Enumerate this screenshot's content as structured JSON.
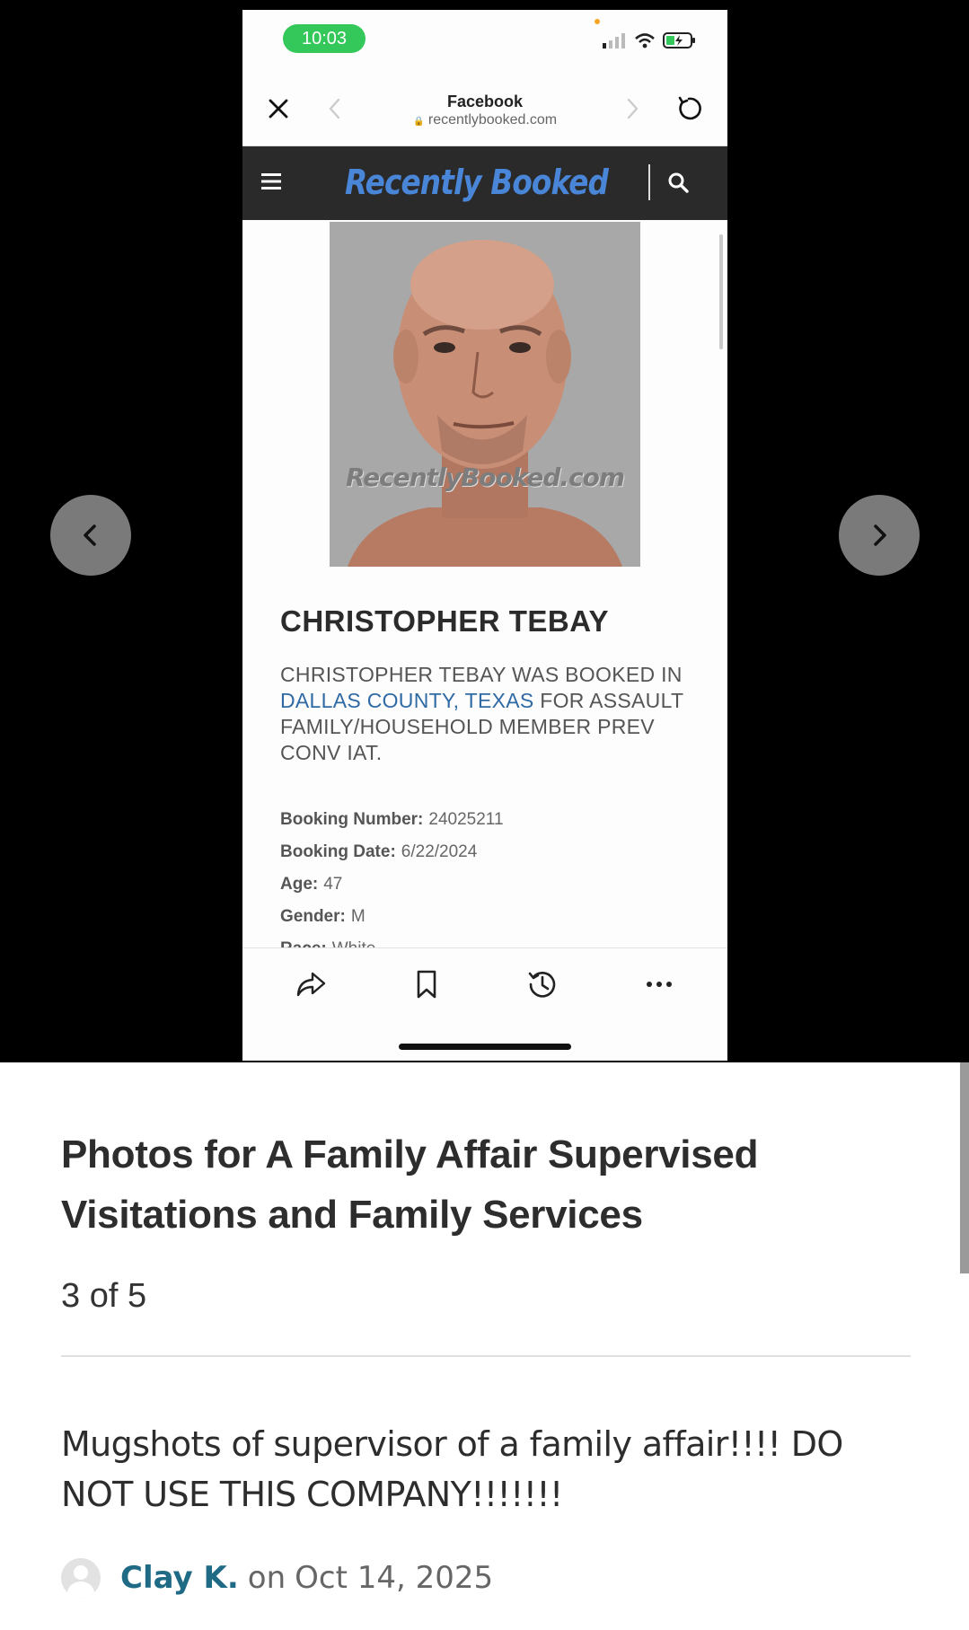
{
  "viewer": {
    "prev_label": "Previous photo",
    "next_label": "Next photo"
  },
  "phone": {
    "time": "10:03",
    "browser": {
      "title": "Facebook",
      "url": "recentlybooked.com"
    },
    "site": {
      "logo": "Recently Booked"
    },
    "mugshot_watermark": "RecentlyBooked.com",
    "person_name": "CHRISTOPHER TEBAY",
    "description": {
      "part1": "CHRISTOPHER TEBAY WAS BOOKED IN ",
      "link": "DALLAS COUNTY, TEXAS",
      "part2": " FOR ASSAULT FAMILY/HOUSEHOLD MEMBER PREV CONV IAT."
    },
    "details": [
      {
        "label": "Booking Number:",
        "value": "24025211"
      },
      {
        "label": "Booking Date:",
        "value": "6/22/2024"
      },
      {
        "label": "Age:",
        "value": "47"
      },
      {
        "label": "Gender:",
        "value": "M"
      },
      {
        "label": "Race:",
        "value": "White"
      }
    ]
  },
  "caption": {
    "title": "Photos for A Family Affair Supervised Visitations and Family Services",
    "counter": "3 of 5",
    "text": "Mugshots of supervisor of a family affair!!!! DO NOT USE THIS COMPANY!!!!!!!",
    "author": "Clay K.",
    "on": "on",
    "date": "Oct 14, 2025"
  },
  "colors": {
    "author_link": "#1f6a85",
    "location_link": "#2f6aa4",
    "logo": "#4a86d8",
    "time_pill": "#34c759"
  },
  "icons": [
    "chevron-left-icon",
    "chevron-right-icon",
    "close-icon",
    "reload-icon",
    "menu-icon",
    "search-icon",
    "share-icon",
    "bookmark-icon",
    "history-icon",
    "more-icon",
    "lock-icon",
    "signal-icon",
    "wifi-icon",
    "battery-icon"
  ]
}
